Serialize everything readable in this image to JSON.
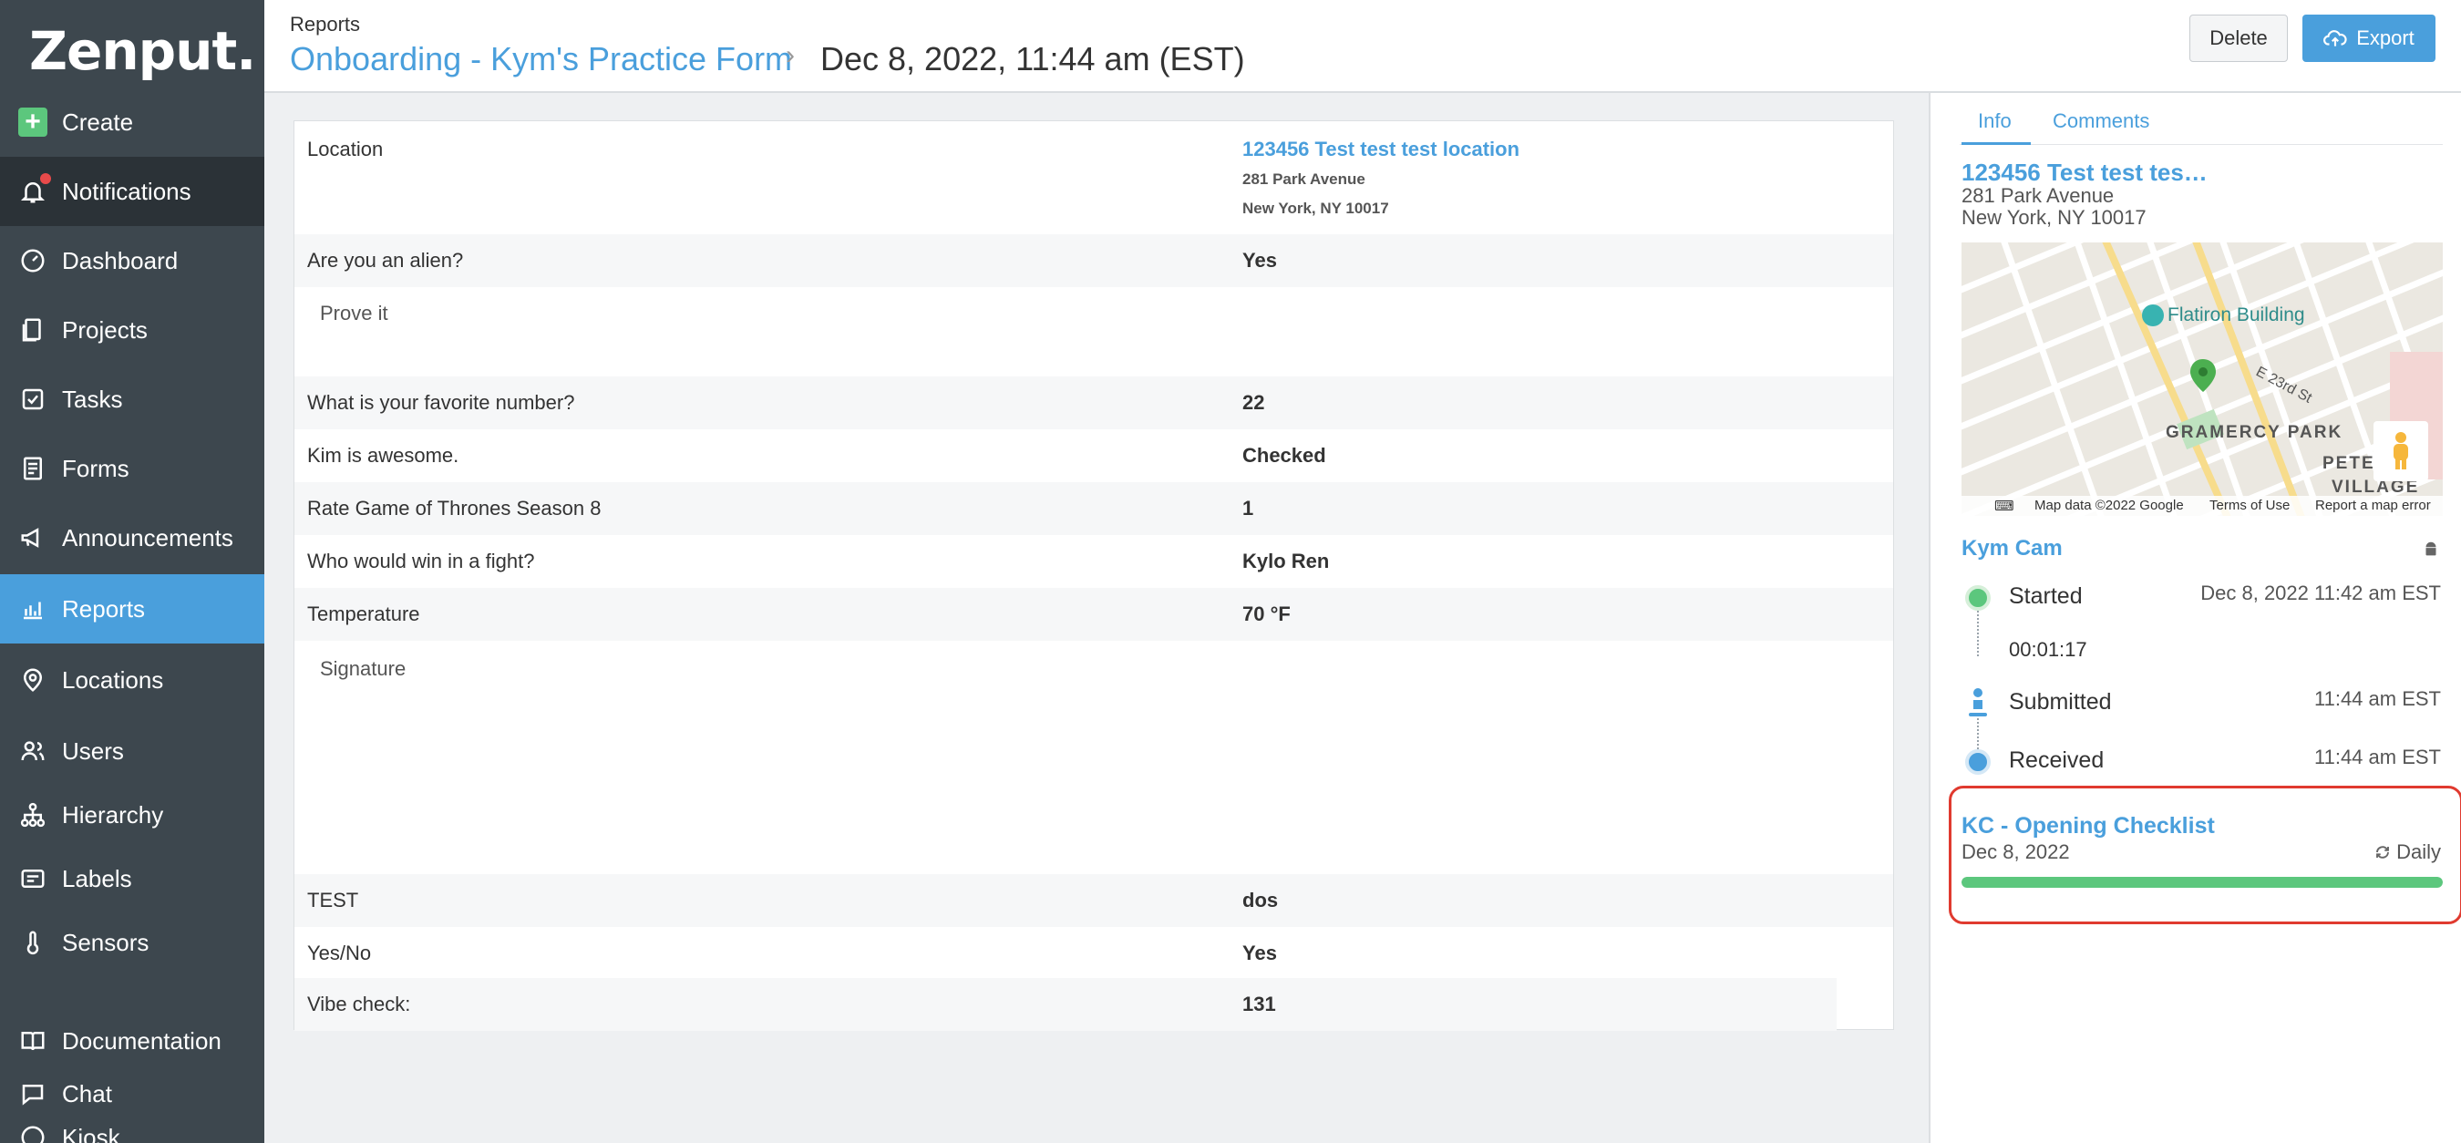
{
  "app": {
    "logo": "Zenput."
  },
  "sidebar": {
    "items": [
      {
        "label": "Create"
      },
      {
        "label": "Notifications"
      },
      {
        "label": "Dashboard"
      },
      {
        "label": "Projects"
      },
      {
        "label": "Tasks"
      },
      {
        "label": "Forms"
      },
      {
        "label": "Announcements"
      },
      {
        "label": "Reports"
      },
      {
        "label": "Locations"
      },
      {
        "label": "Users"
      },
      {
        "label": "Hierarchy"
      },
      {
        "label": "Labels"
      },
      {
        "label": "Sensors"
      },
      {
        "label": "Documentation"
      },
      {
        "label": "Chat"
      },
      {
        "label": "Kiosk"
      }
    ],
    "colors": {
      "bg": "#3d474e",
      "active": "#4a9fdc",
      "create": "#5cc77d",
      "notification_dot": "#e84a4a"
    }
  },
  "header": {
    "breadcrumb": "Reports",
    "form_title": "Onboarding - Kym's Practice Form",
    "separator": "›",
    "submission_date": "Dec 8, 2022, 11:44 am (EST)",
    "delete_label": "Delete",
    "export_label": "Export"
  },
  "form": {
    "location": {
      "question": "Location",
      "name": "123456 Test test test location",
      "address1": "281 Park Avenue",
      "address2": "New York, NY  10017"
    },
    "rows": [
      {
        "question": "Are you an alien?",
        "answer": "Yes"
      },
      {
        "sub": "Prove it"
      },
      {
        "question": "What is your favorite number?",
        "answer": "22"
      },
      {
        "question": "Kim is awesome.",
        "answer": "Checked"
      },
      {
        "question": "Rate Game of Thrones Season 8",
        "answer": "1"
      },
      {
        "question": "Who would win in a fight?",
        "answer": "Kylo Ren"
      },
      {
        "question": "Temperature",
        "answer": "70 °F"
      },
      {
        "sub": "Signature"
      },
      {
        "question": "TEST",
        "answer": "dos"
      },
      {
        "question": "Yes/No",
        "answer": "Yes"
      },
      {
        "question": "Vibe check:",
        "answer": "131"
      }
    ]
  },
  "info_panel": {
    "tabs": [
      {
        "label": "Info"
      },
      {
        "label": "Comments"
      }
    ],
    "location_name": "123456 Test test tes…",
    "address1": "281 Park Avenue",
    "address2": "New York, NY 10017",
    "map": {
      "labels": {
        "poi": "Flatiron Building",
        "district1": "GRAMERCY PARK",
        "district2": "PETER",
        "district3": "VILLAGE",
        "street": "E 23rd St"
      },
      "footer": {
        "data": "Map data ©2022 Google",
        "terms": "Terms of Use",
        "report": "Report a map error"
      }
    },
    "user": "Kym Cam",
    "timeline": [
      {
        "label": "Started",
        "time": "Dec 8, 2022 11:42 am EST"
      },
      {
        "label": "00:01:17"
      },
      {
        "label": "Submitted",
        "time": "11:44 am EST"
      },
      {
        "label": "Received",
        "time": "11:44 am EST"
      }
    ],
    "checklist": {
      "title": "KC - Opening Checklist",
      "date": "Dec 8, 2022",
      "frequency": "Daily",
      "progress": 1.0
    }
  }
}
